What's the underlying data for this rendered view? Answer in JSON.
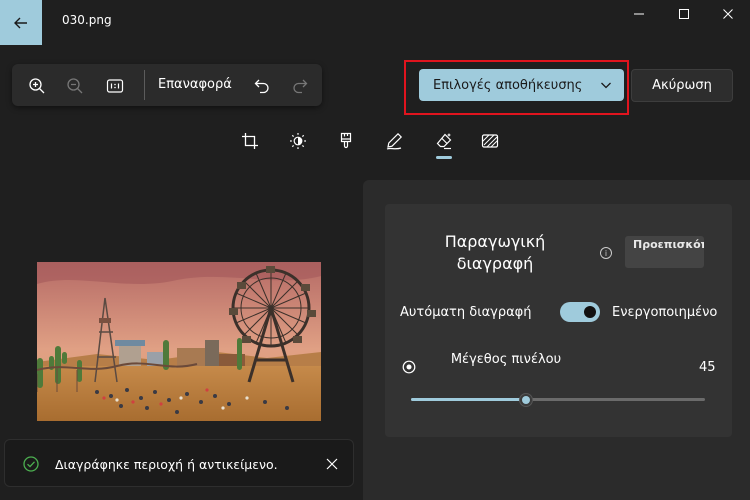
{
  "window": {
    "title": "030.png"
  },
  "toolbar": {
    "reset_label": "Επαναφορά",
    "zoom_in_icon": "zoom-in-icon",
    "zoom_out_icon": "zoom-out-icon",
    "actual_size_icon": "actual-size-icon",
    "undo_icon": "undo-icon",
    "redo_icon": "redo-icon"
  },
  "actions": {
    "save_options_label": "Επιλογές αποθήκευσης",
    "cancel_label": "Ακύρωση"
  },
  "tools": [
    {
      "name": "crop",
      "icon": "crop-icon",
      "active": false
    },
    {
      "name": "adjust",
      "icon": "brightness-icon",
      "active": false
    },
    {
      "name": "filter",
      "icon": "filter-icon",
      "active": false
    },
    {
      "name": "markup",
      "icon": "pen-icon",
      "active": false
    },
    {
      "name": "erase",
      "icon": "eraser-icon",
      "active": true
    },
    {
      "name": "background",
      "icon": "background-icon",
      "active": false
    }
  ],
  "panel": {
    "title": "Παραγωγική διαγραφή",
    "preview_badge": "Προεπισκόπηση",
    "auto_erase_label": "Αυτόματη διαγραφή",
    "auto_erase_state": "Ενεργοποιημένο",
    "auto_erase_on": true,
    "brush_size_label": "Μέγεθος πινέλου",
    "brush_size_value": "45",
    "brush_size_fraction": 0.39
  },
  "toast": {
    "message": "Διαγράφηκε περιοχή ή αντικείμενο."
  },
  "colors": {
    "accent": "#9fcbdc",
    "highlight": "#e0141e",
    "background": "#1f1f1f",
    "panel": "#2b2b2b",
    "success": "#4caf50"
  }
}
